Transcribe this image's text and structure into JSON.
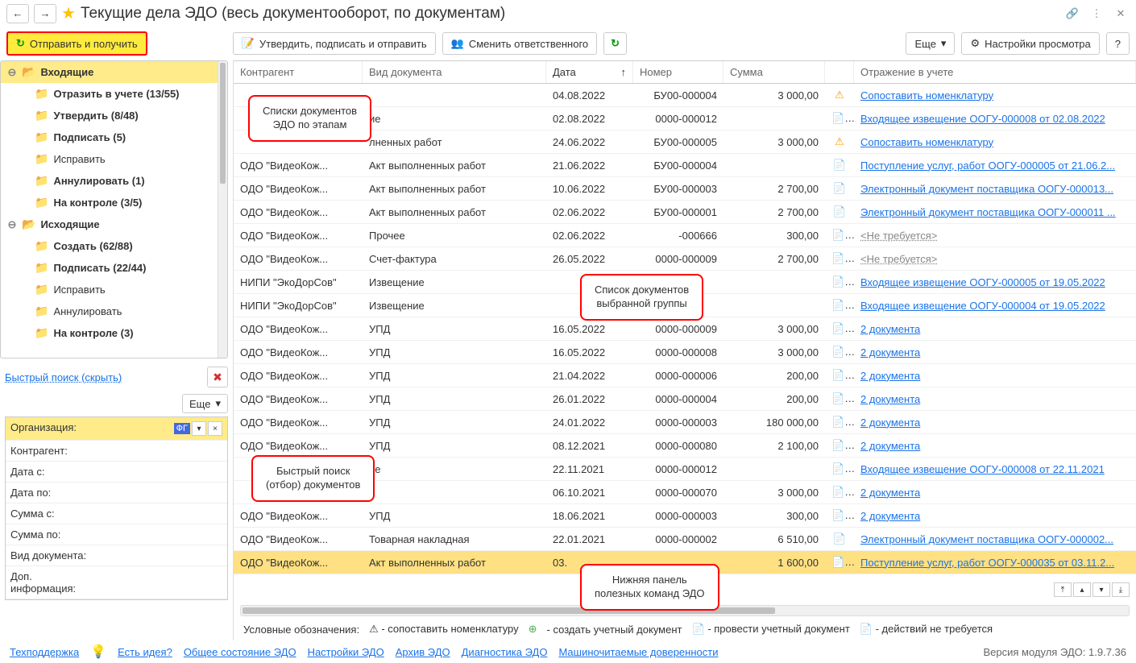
{
  "header": {
    "title": "Текущие дела ЭДО (весь документооборот, по документам)"
  },
  "toolbar": {
    "send_receive": "Отправить и получить",
    "approve": "Утвердить, подписать и отправить",
    "change_resp": "Сменить ответственного",
    "more": "Еще",
    "view_settings": "Настройки просмотра"
  },
  "tree": {
    "incoming": "Входящие",
    "incoming_items": [
      {
        "label": "Отразить в учете (13/55)"
      },
      {
        "label": "Утвердить (8/48)"
      },
      {
        "label": "Подписать (5)"
      },
      {
        "label": "Исправить"
      },
      {
        "label": "Аннулировать (1)"
      },
      {
        "label": "На контроле (3/5)"
      }
    ],
    "outgoing": "Исходящие",
    "outgoing_items": [
      {
        "label": "Создать (62/88)"
      },
      {
        "label": "Подписать (22/44)"
      },
      {
        "label": "Исправить"
      },
      {
        "label": "Аннулировать"
      },
      {
        "label": "На контроле (3)"
      }
    ]
  },
  "quick_search": {
    "link": "Быстрый поиск (скрыть)",
    "more": "Еще"
  },
  "filters": {
    "org_label": "Организация:",
    "org_value": "ФГ",
    "agent": "Контрагент:",
    "date_from": "Дата с:",
    "date_to": "Дата по:",
    "sum_from": "Сумма с:",
    "sum_to": "Сумма по:",
    "doc_type": "Вид документа:",
    "extra": "Доп. информация:"
  },
  "columns": {
    "agent": "Контрагент",
    "doc": "Вид документа",
    "date": "Дата",
    "num": "Номер",
    "sum": "Сумма",
    "reflect": "Отражение в учете"
  },
  "rows": [
    {
      "agent": "",
      "doc": "",
      "date": "04.08.2022",
      "num": "БУ00-000004",
      "sum": "3 000,00",
      "icon": "warn",
      "link": "Сопоставить номенклатуру"
    },
    {
      "agent": "",
      "doc": "ие",
      "date": "02.08.2022",
      "num": "0000-000012",
      "sum": "",
      "icon": "doc",
      "link": "Входящее извещение ООГУ-000008 от 02.08.2022"
    },
    {
      "agent": "",
      "doc": "лненных работ",
      "date": "24.06.2022",
      "num": "БУ00-000005",
      "sum": "3 000,00",
      "icon": "warn",
      "link": "Сопоставить номенклатуру"
    },
    {
      "agent": "ОДО \"ВидеоКож...",
      "doc": "Акт выполненных работ",
      "date": "21.06.2022",
      "num": "БУ00-000004",
      "sum": "",
      "icon": "doc2",
      "link": "Поступление услуг, работ ООГУ-000005 от 21.06.2..."
    },
    {
      "agent": "ОДО \"ВидеоКож...",
      "doc": "Акт выполненных работ",
      "date": "10.06.2022",
      "num": "БУ00-000003",
      "sum": "2 700,00",
      "icon": "doc2",
      "link": "Электронный документ поставщика ООГУ-000013..."
    },
    {
      "agent": "ОДО \"ВидеоКож...",
      "doc": "Акт выполненных работ",
      "date": "02.06.2022",
      "num": "БУ00-000001",
      "sum": "2 700,00",
      "icon": "doc2",
      "link": "Электронный документ поставщика ООГУ-000011 ..."
    },
    {
      "agent": "ОДО \"ВидеоКож...",
      "doc": "Прочее",
      "date": "02.06.2022",
      "num": "-000666",
      "sum": "300,00",
      "icon": "doc",
      "link": "<Не требуется>",
      "nr": true
    },
    {
      "agent": "ОДО \"ВидеоКож...",
      "doc": "Счет-фактура",
      "date": "26.05.2022",
      "num": "0000-000009",
      "sum": "2 700,00",
      "icon": "doc",
      "link": "<Не требуется>",
      "nr": true
    },
    {
      "agent": "НИПИ \"ЭкоДорСов\"",
      "doc": "Извещение",
      "date": "",
      "num": "",
      "sum": "",
      "icon": "doc",
      "link": "Входящее извещение ООГУ-000005 от 19.05.2022"
    },
    {
      "agent": "НИПИ \"ЭкоДорСов\"",
      "doc": "Извещение",
      "date": "",
      "num": "",
      "sum": "",
      "icon": "doc",
      "link": "Входящее извещение ООГУ-000004 от 19.05.2022"
    },
    {
      "agent": "ОДО \"ВидеоКож...",
      "doc": "УПД",
      "date": "16.05.2022",
      "num": "0000-000009",
      "sum": "3 000,00",
      "icon": "doc",
      "link": "2 документа"
    },
    {
      "agent": "ОДО \"ВидеоКож...",
      "doc": "УПД",
      "date": "16.05.2022",
      "num": "0000-000008",
      "sum": "3 000,00",
      "icon": "doc",
      "link": "2 документа"
    },
    {
      "agent": "ОДО \"ВидеоКож...",
      "doc": "УПД",
      "date": "21.04.2022",
      "num": "0000-000006",
      "sum": "200,00",
      "icon": "doc",
      "link": "2 документа"
    },
    {
      "agent": "ОДО \"ВидеоКож...",
      "doc": "УПД",
      "date": "26.01.2022",
      "num": "0000-000004",
      "sum": "200,00",
      "icon": "doc",
      "link": "2 документа"
    },
    {
      "agent": "ОДО \"ВидеоКож...",
      "doc": "УПД",
      "date": "24.01.2022",
      "num": "0000-000003",
      "sum": "180 000,00",
      "icon": "doc",
      "link": "2 документа"
    },
    {
      "agent": "ОДО \"ВидеоКож...",
      "doc": "УПД",
      "date": "08.12.2021",
      "num": "0000-000080",
      "sum": "2 100,00",
      "icon": "doc",
      "link": "2 документа"
    },
    {
      "agent": "",
      "doc": "ие",
      "date": "22.11.2021",
      "num": "0000-000012",
      "sum": "",
      "icon": "doc",
      "link": "Входящее извещение ООГУ-000008 от 22.11.2021"
    },
    {
      "agent": "",
      "doc": "",
      "date": "06.10.2021",
      "num": "0000-000070",
      "sum": "3 000,00",
      "icon": "doc",
      "link": "2 документа"
    },
    {
      "agent": "ОДО \"ВидеоКож...",
      "doc": "УПД",
      "date": "18.06.2021",
      "num": "0000-000003",
      "sum": "300,00",
      "icon": "doc",
      "link": "2 документа"
    },
    {
      "agent": "ОДО \"ВидеоКож...",
      "doc": "Товарная накладная",
      "date": "22.01.2021",
      "num": "0000-000002",
      "sum": "6 510,00",
      "icon": "doc2",
      "link": "Электронный документ поставщика ООГУ-000002..."
    },
    {
      "agent": "ОДО \"ВидеоКож...",
      "doc": "Акт выполненных работ",
      "date": "03.",
      "num": "",
      "sum": "1 600,00",
      "icon": "doc",
      "link": "Поступление услуг, работ ООГУ-000035 от 03.11.2...",
      "sel": true
    }
  ],
  "legend": {
    "title": "Условные обозначения:",
    "i1": "- сопоставить номенклатуру",
    "i2": "- создать учетный документ",
    "i3": "- провести учетный документ",
    "i4": "- действий не требуется"
  },
  "footer": {
    "support": "Техподдержка",
    "idea": "Есть идея?",
    "l1": "Общее состояние ЭДО",
    "l2": "Настройки ЭДО",
    "l3": "Архив ЭДО",
    "l4": "Диагностика ЭДО",
    "l5": "Машиночитаемые доверенности",
    "version": "Версия модуля ЭДО: 1.9.7.36"
  },
  "callouts": {
    "c1a": "Списки документов",
    "c1b": "ЭДО по этапам",
    "c2a": "Список документов",
    "c2b": "выбранной группы",
    "c3a": "Быстрый поиск",
    "c3b": "(отбор) документов",
    "c4a": "Нижняя панель",
    "c4b": "полезных команд ЭДО"
  }
}
